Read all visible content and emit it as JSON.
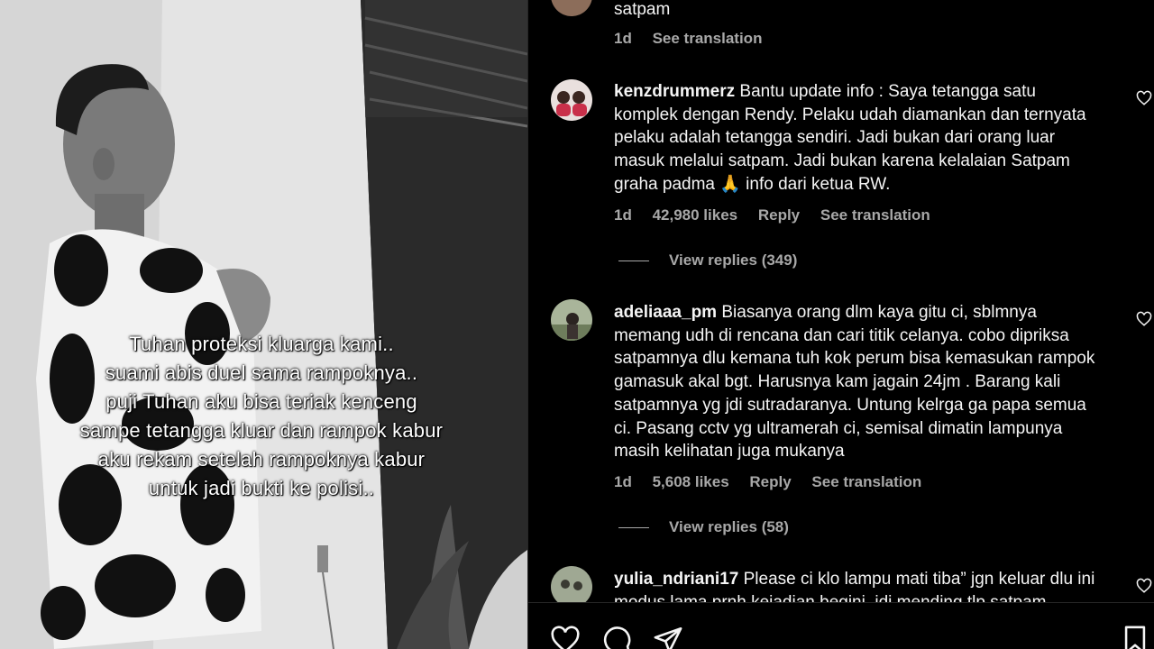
{
  "post": {
    "caption_lines": [
      "Tuhan proteksi kluarga kami..",
      "suami abis duel sama rampoknya..",
      "puji Tuhan aku bisa teriak kenceng",
      "sampe tetangga kluar dan rampok kabur",
      "aku rekam setelah rampoknya kabur",
      "untuk jadi bukti ke polisi.."
    ]
  },
  "comments": [
    {
      "text": "satpam",
      "meta": {
        "time": "1d",
        "translate": "See translation"
      }
    },
    {
      "username": "kenzdrummerz",
      "text": "Bantu update info : Saya tetangga satu komplek dengan Rendy. Pelaku udah diamankan dan ternyata pelaku adalah tetangga sendiri. Jadi bukan dari orang luar masuk melalui satpam. Jadi bukan karena kelalaian Satpam graha padma 🙏 info dari ketua RW.",
      "meta": {
        "time": "1d",
        "likes": "42,980 likes",
        "reply": "Reply",
        "translate": "See translation"
      },
      "view_replies": "View replies (349)"
    },
    {
      "username": "adeliaaa_pm",
      "text": "Biasanya orang dlm kaya gitu ci, sblmnya memang udh di rencana dan cari titik celanya. cobo dipriksa satpamnya dlu kemana tuh kok perum bisa kemasukan rampok gamasuk akal bgt. Harusnya kam jagain 24jm . Barang kali satpamnya yg jdi sutradaranya. Untung kelrga ga papa semua ci. Pasang cctv yg ultramerah ci, semisal dimatin lampunya masih kelihatan juga mukanya",
      "meta": {
        "time": "1d",
        "likes": "5,608 likes",
        "reply": "Reply",
        "translate": "See translation"
      },
      "view_replies": "View replies (58)"
    },
    {
      "username": "yulia_ndriani17",
      "text": "Please ci klo lampu mati tiba” jgn keluar dlu ini modus lama prnh kejadian begini, jdi mending tlp satpam"
    }
  ]
}
